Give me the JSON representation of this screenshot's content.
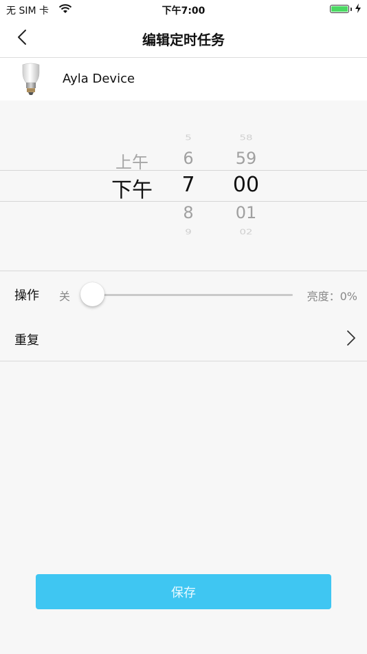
{
  "status_bar": {
    "carrier": "无 SIM 卡",
    "time": "下午7:00",
    "battery_color": "#4cd964"
  },
  "nav": {
    "title": "编辑定时任务",
    "back_icon": "chevron-left-icon"
  },
  "device": {
    "name": "Ayla Device",
    "icon": "light-bulb-icon"
  },
  "picker": {
    "ampm": [
      "上午",
      "下午"
    ],
    "ampm_selected": "下午",
    "hours": [
      "5",
      "6",
      "7",
      "8",
      "9"
    ],
    "hour_selected": "7",
    "minutes": [
      "58",
      "59",
      "00",
      "01",
      "02"
    ],
    "minute_selected": "00"
  },
  "operation": {
    "label": "操作",
    "off_label": "关",
    "brightness_label": "亮度：0%",
    "slider_value_percent": 0
  },
  "repeat": {
    "label": "重复"
  },
  "save": {
    "label": "保存",
    "color": "#3fc6f2"
  }
}
